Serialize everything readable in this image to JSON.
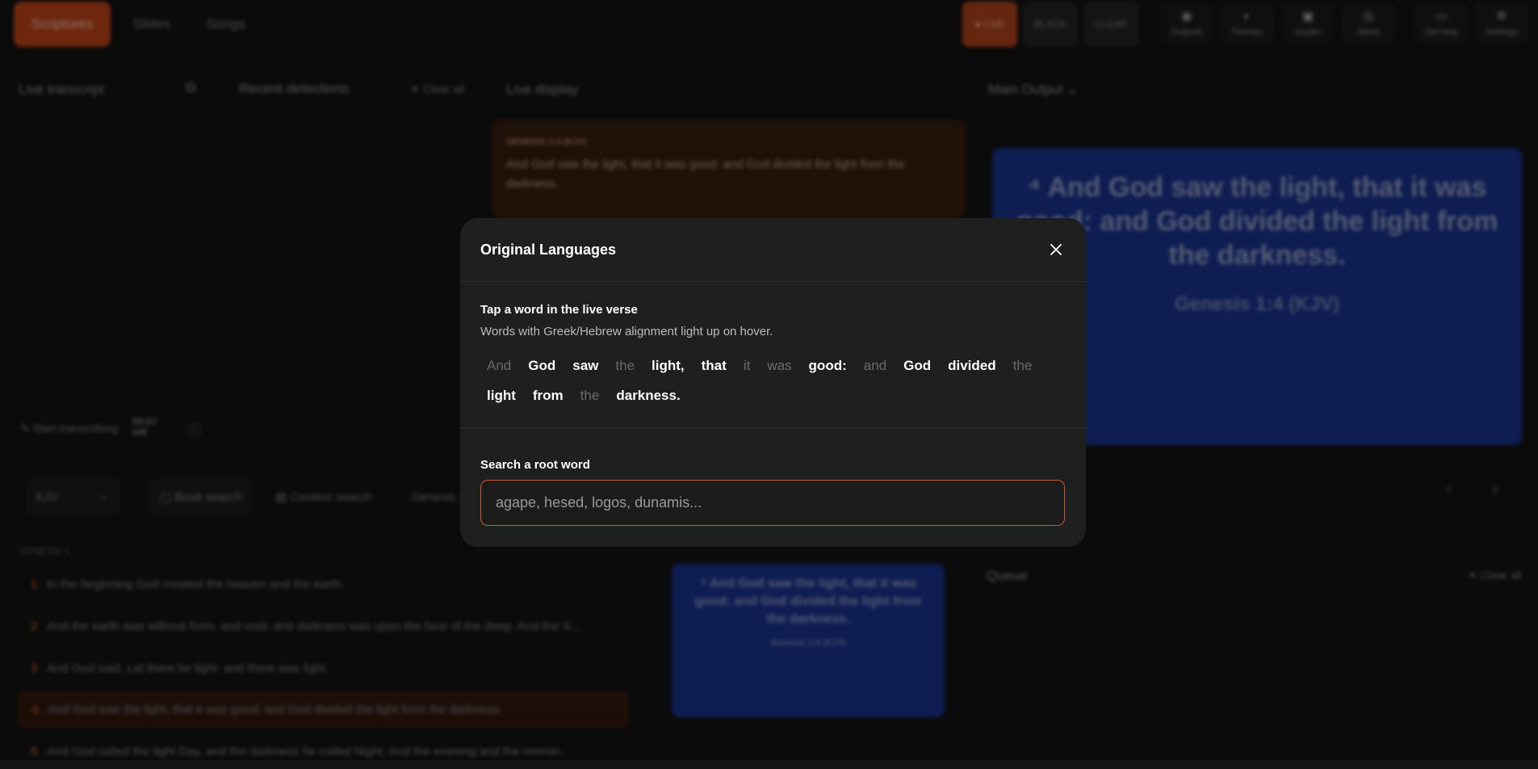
{
  "topbar": {
    "tabs": [
      {
        "label": "Scriptures",
        "active": true
      },
      {
        "label": "Slides",
        "active": false
      },
      {
        "label": "Songs",
        "active": false
      }
    ],
    "modes": [
      {
        "label": "● LIVE"
      },
      {
        "label": "BLACK"
      },
      {
        "label": "CLEAR"
      }
    ],
    "tools": [
      {
        "label": "Outputs",
        "icon": "broadcast-icon"
      },
      {
        "label": "Themes",
        "icon": "palette-icon"
      },
      {
        "label": "Studio",
        "icon": "studio-icon"
      },
      {
        "label": "Alerts",
        "icon": "bell-icon"
      },
      {
        "label": "Get help",
        "icon": "chat-icon"
      },
      {
        "label": "Settings",
        "icon": "gear-icon"
      }
    ]
  },
  "panels": {
    "live_transcript": "Live transcript",
    "recent_detections": "Recent detections",
    "clear_all": "Clear all",
    "live_display": "Live display",
    "main_output": "Main Output",
    "queue": "Queue",
    "queue_clear_all": "Clear all",
    "start_transcribing": "Start transcribing",
    "time_left": "59:57",
    "time_left_unit": "left"
  },
  "live_display_card": {
    "reference": "GENESIS 1:4 (KJV)",
    "text": "And God saw the light, that it was good: and God divided the light from the darkness."
  },
  "main_output": {
    "verse": "⁴ And God saw the light, that it was good: and God divided the light from the darkness.",
    "citation": "Genesis 1:4 (KJV)"
  },
  "preview": {
    "verse": "⁴ And God saw the light, that it was good: and God divided the light from the darkness.",
    "citation": "Genesis 1:4 (KJV)"
  },
  "search_bar": {
    "version": "KJV",
    "book_search": "Book search",
    "context_search": "Context search",
    "current": "Genesis 1"
  },
  "chapter": {
    "heading": "GENESIS 1",
    "verses": [
      {
        "num": "1",
        "text": "In the beginning God created the heaven and the earth."
      },
      {
        "num": "2",
        "text": "And the earth was without form, and void; and darkness was upon the face of the deep. And the S..."
      },
      {
        "num": "3",
        "text": "And God said, Let there be light: and there was light."
      },
      {
        "num": "4",
        "text": "And God saw the light, that it was good: and God divided the light from the darkness.",
        "active": true
      },
      {
        "num": "5",
        "text": "And God called the light Day, and the darkness he called Night. And the evening and the mornin..."
      }
    ]
  },
  "modal": {
    "title": "Original Languages",
    "subtitle": "Tap a word in the live verse",
    "hint": "Words with Greek/Hebrew alignment light up on hover.",
    "words": [
      {
        "text": "And",
        "aligned": false
      },
      {
        "text": "God",
        "aligned": true
      },
      {
        "text": "saw",
        "aligned": true
      },
      {
        "text": "the",
        "aligned": false
      },
      {
        "text": "light,",
        "aligned": true
      },
      {
        "text": "that",
        "aligned": true
      },
      {
        "text": "it",
        "aligned": false
      },
      {
        "text": "was",
        "aligned": false
      },
      {
        "text": "good:",
        "aligned": true
      },
      {
        "text": "and",
        "aligned": false
      },
      {
        "text": "God",
        "aligned": true
      },
      {
        "text": "divided",
        "aligned": true
      },
      {
        "text": "the",
        "aligned": false
      },
      {
        "text": "light",
        "aligned": true
      },
      {
        "text": "from",
        "aligned": true
      },
      {
        "text": "the",
        "aligned": false
      },
      {
        "text": "darkness.",
        "aligned": true
      }
    ],
    "search_label": "Search a root word",
    "search_placeholder": "agape, hesed, logos, dunamis...",
    "search_value": ""
  },
  "colors": {
    "accent": "#c9481a",
    "output_blue": "#1a3596",
    "modal_bg": "#1f1f1f",
    "input_border": "#c95a2a"
  }
}
